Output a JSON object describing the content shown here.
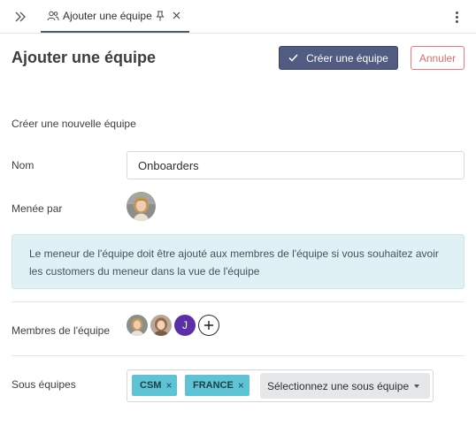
{
  "tab": {
    "label": "Ajouter une équipe"
  },
  "header": {
    "title": "Ajouter une équipe",
    "create_label": "Créer une équipe",
    "cancel_label": "Annuler"
  },
  "form": {
    "subtitle": "Créer une nouvelle équipe",
    "name_label": "Nom",
    "name_value": "Onboarders",
    "leader_label": "Menée par",
    "info_text": "Le meneur de l'équipe doit être ajouté aux membres de l'équipe si vous souhaitez avoir les customers du meneur dans la vue de l'équipe",
    "members_label": "Membres de l'équipe",
    "members": [
      {
        "type": "photo"
      },
      {
        "type": "photo"
      },
      {
        "type": "initial",
        "initial": "J",
        "color": "#5b2fa8"
      }
    ],
    "subteams_label": "Sous équipes",
    "subteam_tags": [
      {
        "label": "CSM",
        "remove": "×"
      },
      {
        "label": "FRANCE",
        "remove": "×"
      }
    ],
    "subteam_select_placeholder": "Sélectionnez une sous équipe"
  },
  "colors": {
    "primary": "#525b82",
    "danger": "#e06c6c",
    "info_bg": "#dff1f5",
    "tag_bg": "#5ec4d5"
  }
}
